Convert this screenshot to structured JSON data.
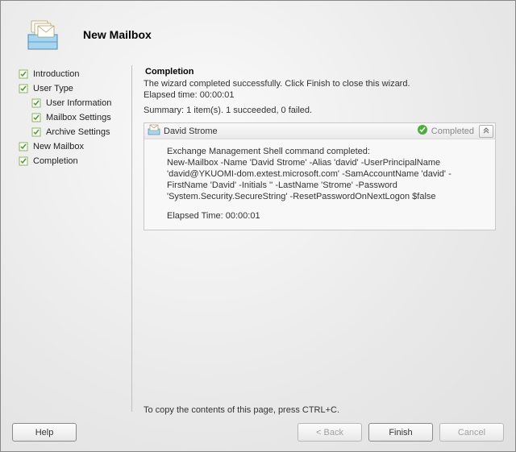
{
  "header": {
    "title": "New Mailbox"
  },
  "sidebar": {
    "items": [
      {
        "label": "Introduction",
        "indent": false
      },
      {
        "label": "User Type",
        "indent": false
      },
      {
        "label": "User Information",
        "indent": true
      },
      {
        "label": "Mailbox Settings",
        "indent": true
      },
      {
        "label": "Archive Settings",
        "indent": true
      },
      {
        "label": "New Mailbox",
        "indent": false
      },
      {
        "label": "Completion",
        "indent": false
      }
    ]
  },
  "content": {
    "title": "Completion",
    "message": "The wizard completed successfully. Click Finish to close this wizard.",
    "elapsed_label": "Elapsed time: 00:00:01",
    "summary": "Summary: 1 item(s). 1 succeeded, 0 failed.",
    "result": {
      "name": "David Strome",
      "status": "Completed",
      "body_line1": "Exchange Management Shell command completed:",
      "body_cmd": "New-Mailbox -Name 'David Strome' -Alias 'david' -UserPrincipalName 'david@YKUOMI-dom.extest.microsoft.com' -SamAccountName 'david' -FirstName 'David' -Initials '' -LastName 'Strome' -Password 'System.Security.SecureString' -ResetPasswordOnNextLogon $false",
      "elapsed": "Elapsed Time: 00:00:01"
    },
    "hint": "To copy the contents of this page, press CTRL+C."
  },
  "buttons": {
    "help": "Help",
    "back": "< Back",
    "finish": "Finish",
    "cancel": "Cancel"
  }
}
